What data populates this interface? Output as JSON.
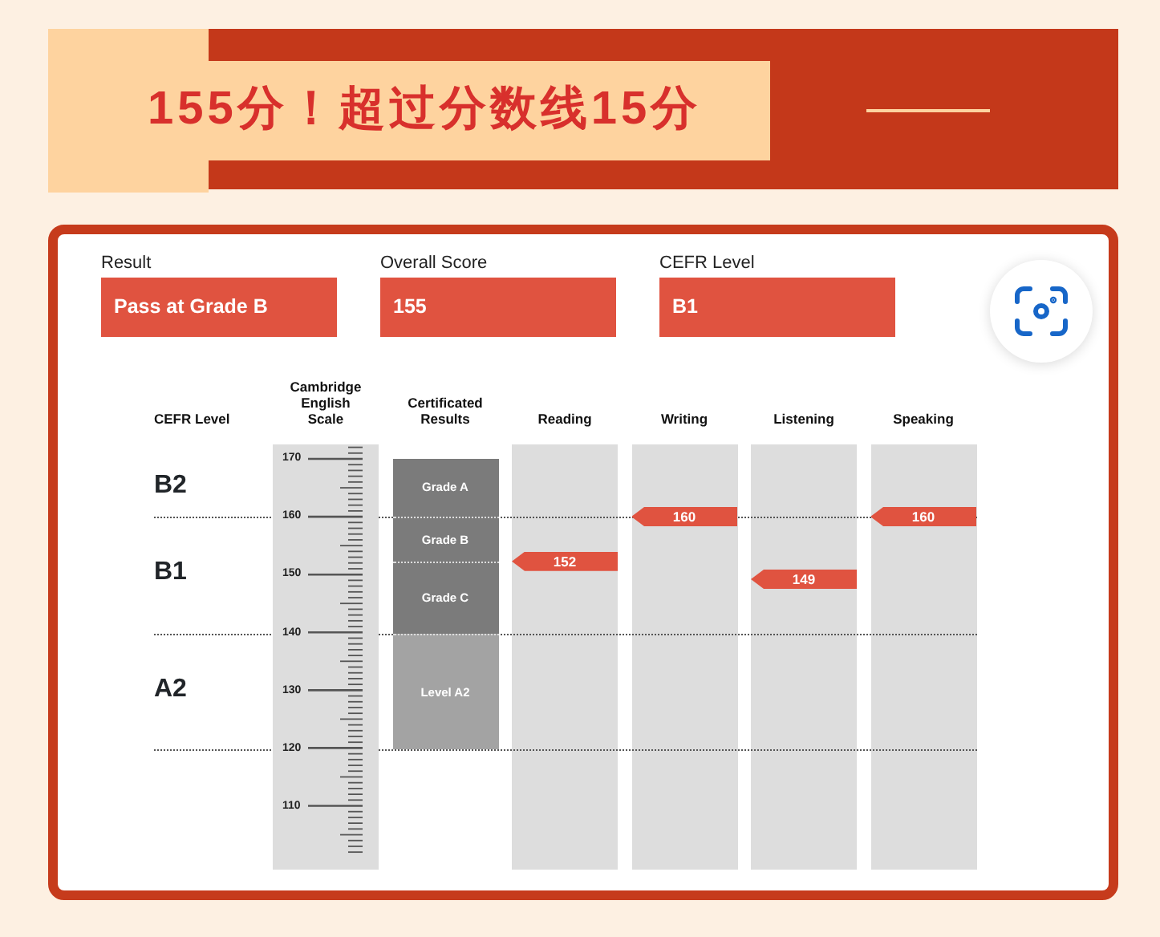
{
  "header": {
    "title": "155分！超过分数线15分"
  },
  "summary": [
    {
      "label": "Result",
      "value": "Pass at Grade B"
    },
    {
      "label": "Overall Score",
      "value": "155"
    },
    {
      "label": "CEFR Level",
      "value": "B1"
    }
  ],
  "chart": {
    "columns": [
      {
        "kind": "levels",
        "heading": "CEFR Level"
      },
      {
        "kind": "scale",
        "heading": "Cambridge English Scale"
      },
      {
        "kind": "results",
        "heading": "Certificated Results"
      },
      {
        "kind": "skill",
        "heading": "Reading",
        "score": "152",
        "level": 0.725
      },
      {
        "kind": "skill",
        "heading": "Writing",
        "score": "160",
        "level": 0.83
      },
      {
        "kind": "skill",
        "heading": "Listening",
        "score": "149",
        "level": 0.683
      },
      {
        "kind": "skill",
        "heading": "Speaking",
        "score": "160",
        "level": 0.83
      }
    ],
    "cefr_levels": [
      {
        "label": "B2"
      },
      {
        "label": "B1"
      },
      {
        "label": "A2"
      }
    ],
    "scale_ticks": [
      {
        "label": "170"
      },
      {
        "label": "160"
      },
      {
        "label": "150"
      },
      {
        "label": "140"
      },
      {
        "label": "130"
      },
      {
        "label": "120"
      },
      {
        "label": "110"
      }
    ],
    "grades": [
      {
        "label": "Grade A",
        "color": "#7b7b7b"
      },
      {
        "label": "Grade B",
        "color": "#7b7b7b"
      },
      {
        "label": "Grade C",
        "color": "#7b7b7b"
      },
      {
        "label": "Level A2",
        "color": "#a3a3a3"
      }
    ]
  }
}
